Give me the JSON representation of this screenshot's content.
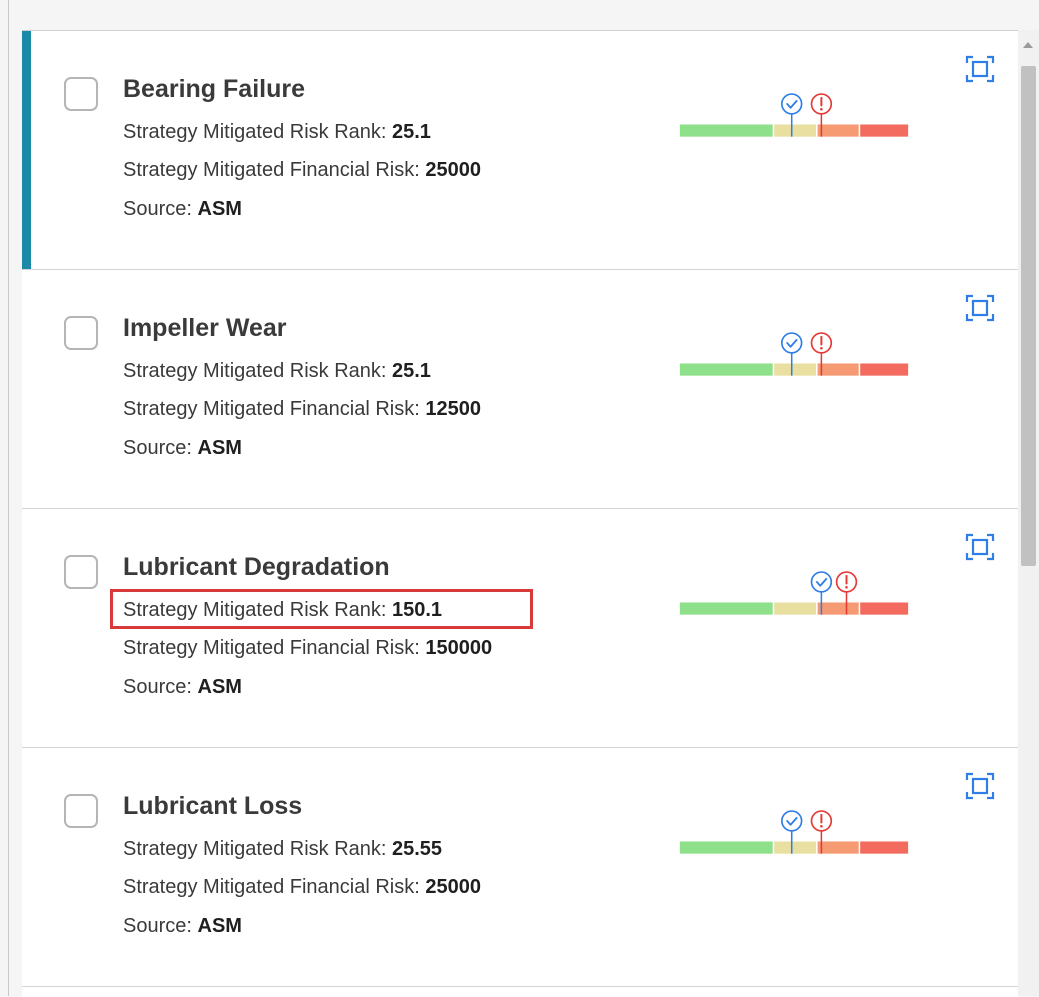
{
  "colors": {
    "selected_accent": "#1a8aa7",
    "checkmark_marker": "#2f7ee6",
    "alert_marker": "#e53935",
    "highlight_box": "#d83a3a",
    "bar_green": "#8fe08a",
    "bar_yellow": "#e8dfa0",
    "bar_orange": "#f59a73",
    "bar_red": "#f26b5e"
  },
  "labels": {
    "risk_rank": "Strategy Mitigated Risk Rank:",
    "financial_risk": "Strategy Mitigated Financial Risk:",
    "source": "Source:"
  },
  "cards": [
    {
      "title": "Bearing Failure",
      "risk_rank": "25.1",
      "financial_risk": "25000",
      "source": "ASM",
      "selected": true,
      "mitigated_marker": 0.49,
      "unmitigated_marker": 0.62
    },
    {
      "title": "Impeller Wear",
      "risk_rank": "25.1",
      "financial_risk": "12500",
      "source": "ASM",
      "selected": false,
      "mitigated_marker": 0.49,
      "unmitigated_marker": 0.62
    },
    {
      "title": "Lubricant Degradation",
      "risk_rank": "150.1",
      "financial_risk": "150000",
      "source": "ASM",
      "selected": false,
      "highlighted_row": "risk_rank",
      "mitigated_marker": 0.62,
      "unmitigated_marker": 0.73
    },
    {
      "title": "Lubricant Loss",
      "risk_rank": "25.55",
      "financial_risk": "25000",
      "source": "ASM",
      "selected": false,
      "mitigated_marker": 0.49,
      "unmitigated_marker": 0.62
    }
  ],
  "icons": {
    "expand": "expand-icon",
    "mitigated": "checkmark-circle-icon",
    "unmitigated": "alert-circle-icon"
  }
}
